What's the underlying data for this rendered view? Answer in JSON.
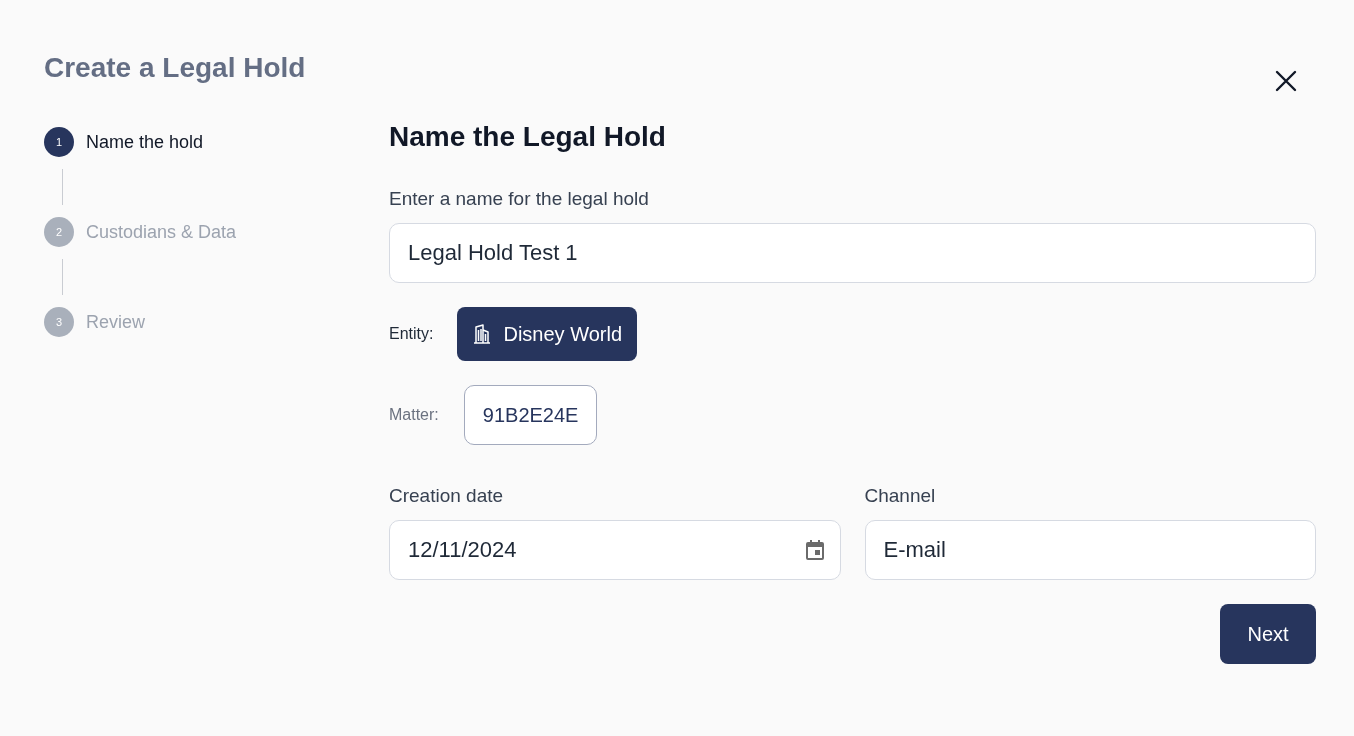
{
  "dialog": {
    "title": "Create a Legal Hold"
  },
  "steps": [
    {
      "number": "1",
      "label": "Name the hold",
      "selected": true
    },
    {
      "number": "2",
      "label": "Custodians & Data",
      "selected": false
    },
    {
      "number": "3",
      "label": "Review",
      "selected": false
    }
  ],
  "form": {
    "heading": "Name the Legal Hold",
    "name_field": {
      "label": "Enter a name for the legal hold",
      "value": "Legal Hold Test 1"
    },
    "entity": {
      "label": "Entity:",
      "value": "Disney World"
    },
    "matter": {
      "label": "Matter:",
      "value": "91B2E24E"
    },
    "creation_date": {
      "label": "Creation date",
      "value": "12/11/2024"
    },
    "channel": {
      "label": "Channel",
      "value": "E-mail"
    }
  },
  "buttons": {
    "next": "Next"
  }
}
